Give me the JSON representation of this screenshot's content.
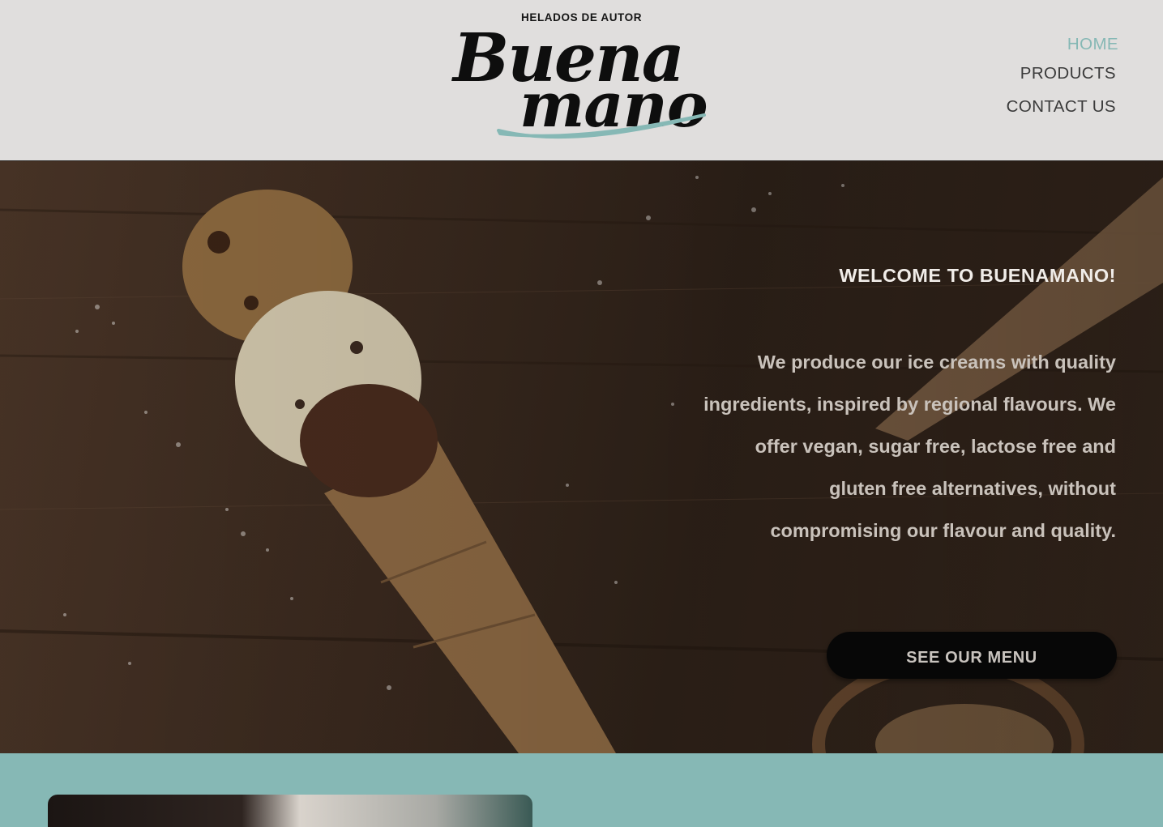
{
  "header": {
    "logo": {
      "tagline": "HELADOS DE AUTOR",
      "word1": "Buena",
      "word2": "mano",
      "swoosh_color": "#86b8b5"
    },
    "nav": [
      {
        "label": "HOME",
        "active": true
      },
      {
        "label": "PRODUCTS",
        "active": false
      },
      {
        "label": "CONTACT US",
        "active": false
      }
    ]
  },
  "hero": {
    "title": "WELCOME TO BUENAMANO!",
    "body": "We produce our ice creams with quality ingredients, inspired by regional flavours.  We offer vegan, sugar free, lactose free and gluten free alternatives, without compromising our flavour and quality.",
    "cta_label": "SEE OUR MENU"
  },
  "colors": {
    "accent": "#86b8b5",
    "header_bg": "#e0dedd",
    "button_bg": "#070707"
  },
  "icons": [
    "ice-cream-image"
  ]
}
